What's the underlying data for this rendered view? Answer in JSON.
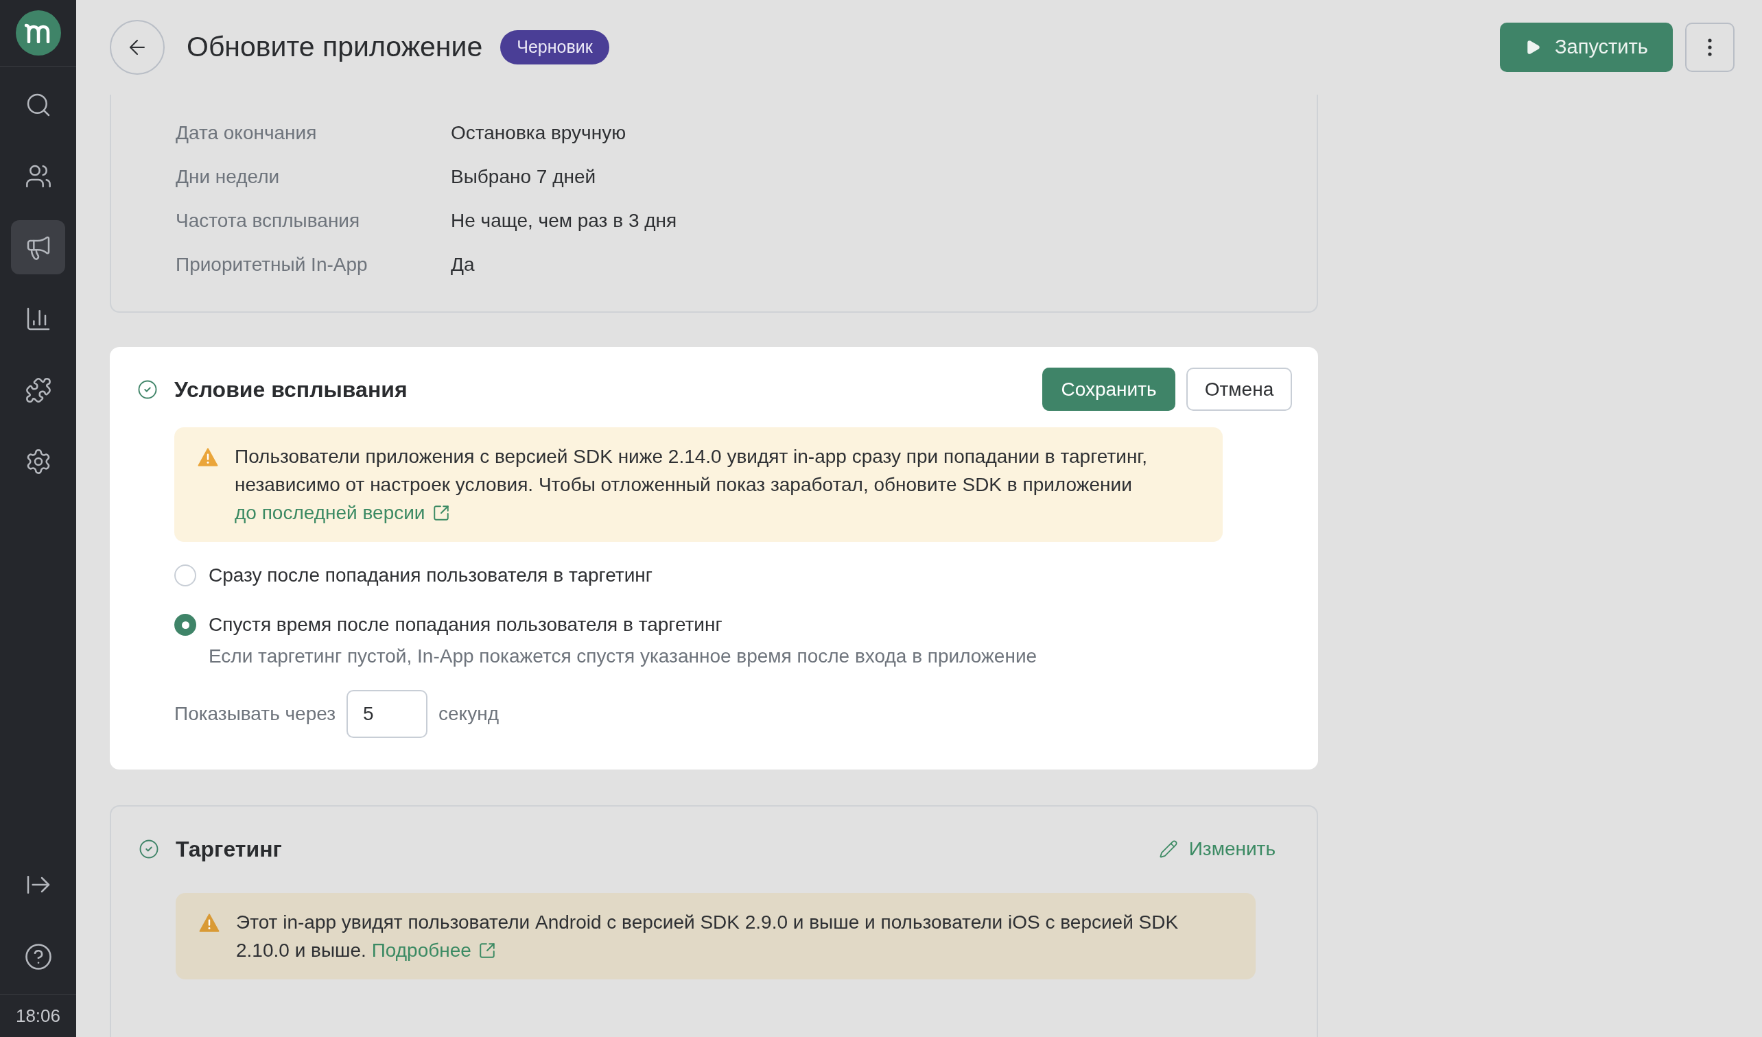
{
  "sidebar": {
    "items": [
      {
        "selected": false
      },
      {
        "selected": false
      },
      {
        "selected": true
      },
      {
        "selected": false
      },
      {
        "selected": false
      },
      {
        "selected": false
      }
    ],
    "time": "18:06"
  },
  "header": {
    "title": "Обновите приложение",
    "badge": "Черновик",
    "run_label": "Запустить"
  },
  "summary": {
    "rows": [
      {
        "label": "Дата окончания",
        "value": "Остановка вручную"
      },
      {
        "label": "Дни недели",
        "value": "Выбрано 7 дней"
      },
      {
        "label": "Частота всплывания",
        "value": "Не чаще, чем раз в 3 дня"
      },
      {
        "label": "Приоритетный In-App",
        "value": "Да"
      }
    ]
  },
  "condition": {
    "title": "Условие всплывания",
    "save_label": "Сохранить",
    "cancel_label": "Отмена",
    "alert": {
      "text": "Пользователи приложения с версией SDK ниже 2.14.0 увидят in-app сразу при попадании в таргетинг, независимо от настроек условия. Чтобы отложенный показ заработал, обновите SDK в приложении",
      "link": "до последней версии"
    },
    "options": [
      {
        "label": "Сразу после попадания пользователя в таргетинг",
        "selected": false
      },
      {
        "label": "Спустя время после попадания пользователя в таргетинг",
        "selected": true,
        "hint": "Если таргетинг пустой, In-App покажется спустя указанное время после входа в приложение"
      }
    ],
    "delay": {
      "label": "Показывать через",
      "value": "5",
      "unit": "секунд"
    }
  },
  "targeting": {
    "title": "Таргетинг",
    "edit_label": "Изменить",
    "alert": {
      "text": "Этот in-app увидят пользователи Android с версией SDK 2.9.0 и выше и пользователи iOS с версией SDK 2.10.0 и выше.",
      "link": "Подробнее"
    }
  }
}
